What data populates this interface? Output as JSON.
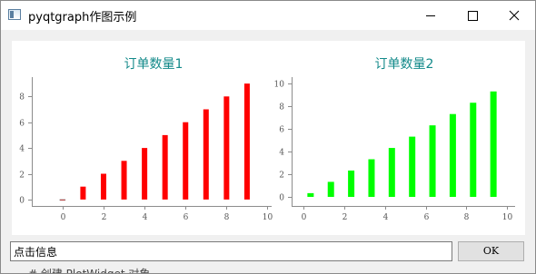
{
  "window": {
    "title": "pyqtgraph作图示例",
    "icon": "app-window-icon",
    "controls": [
      "minimize",
      "maximize",
      "close"
    ]
  },
  "chart_data": [
    {
      "type": "bar",
      "title": "订单数量1",
      "title_color": "#138a8a",
      "bar_color": "#ff0000",
      "x": [
        0,
        1,
        2,
        3,
        4,
        5,
        6,
        7,
        8,
        9
      ],
      "values": [
        0,
        1,
        2,
        3,
        4,
        5,
        6,
        7,
        8,
        9
      ],
      "xlim": [
        -1.5,
        10.2
      ],
      "ylim": [
        -0.5,
        9.5
      ],
      "xticks": [
        0,
        2,
        4,
        6,
        8,
        10
      ],
      "yticks": [
        0,
        2,
        4,
        6,
        8
      ],
      "xticklabels": [
        "0",
        "2",
        "4",
        "6",
        "8",
        "10"
      ],
      "yticklabels": [
        "0",
        "2",
        "4",
        "6",
        "8"
      ]
    },
    {
      "type": "bar",
      "title": "订单数量2",
      "title_color": "#138a8a",
      "bar_color": "#00ff00",
      "x": [
        0.333,
        1.333,
        2.333,
        3.333,
        4.333,
        5.333,
        6.333,
        7.333,
        8.333,
        9.333
      ],
      "values": [
        0.333,
        1.333,
        2.333,
        3.333,
        4.333,
        5.333,
        6.333,
        7.333,
        8.333,
        9.333
      ],
      "xlim": [
        -0.6,
        10.4
      ],
      "ylim": [
        -0.8,
        10.6
      ],
      "xticks": [
        0,
        2,
        4,
        6,
        8,
        10
      ],
      "yticks": [
        0,
        2,
        4,
        6,
        8,
        10
      ],
      "xticklabels": [
        "0",
        "2",
        "4",
        "6",
        "8",
        "10"
      ],
      "yticklabels": [
        "0",
        "2",
        "4",
        "6",
        "8",
        "10"
      ]
    }
  ],
  "info_input": {
    "value": "点击信息"
  },
  "ok_button": {
    "label": "OK"
  },
  "background_text": "# 创建 PlotWidget 对象"
}
